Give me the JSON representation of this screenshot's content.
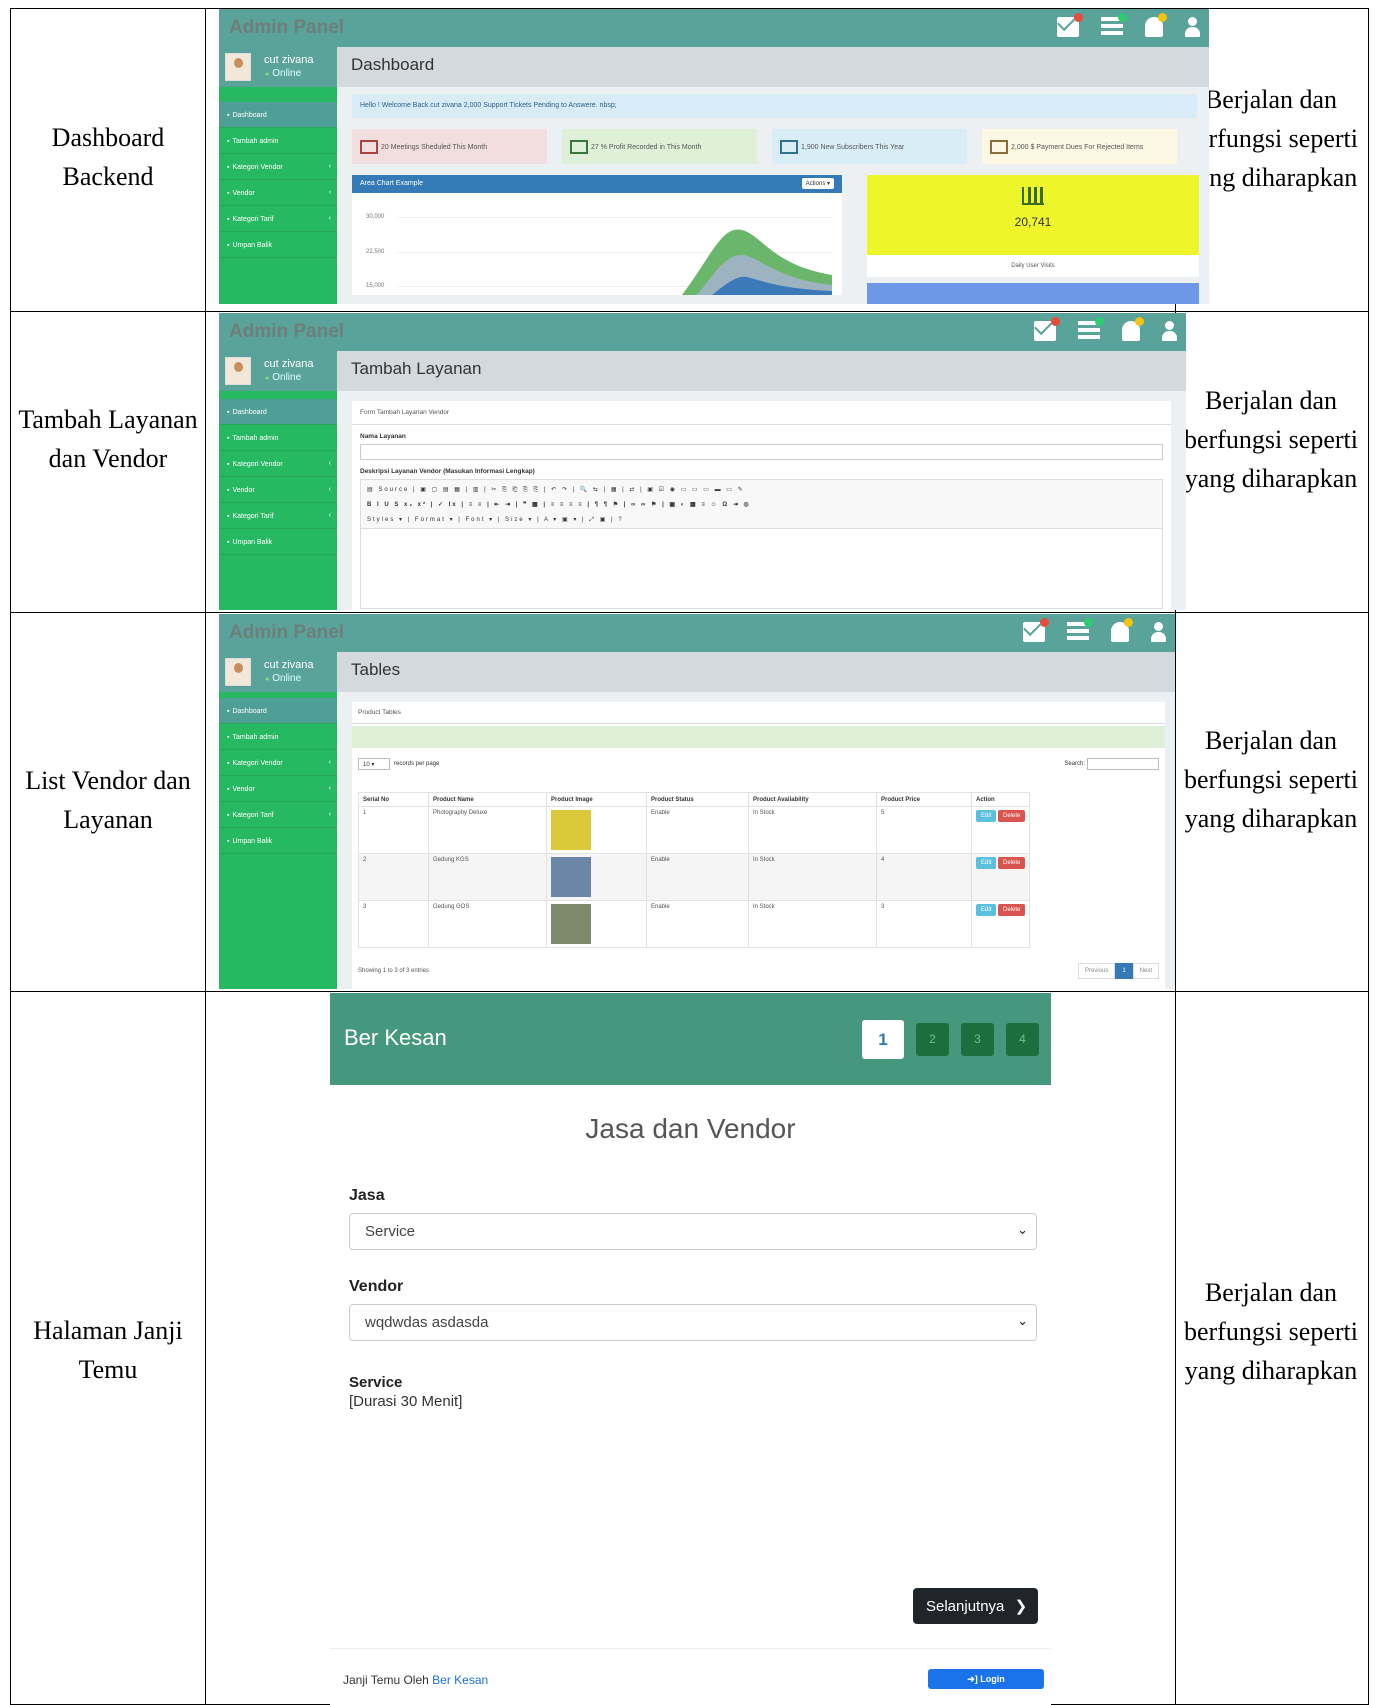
{
  "rows": [
    {
      "label": "Dashboard Backend",
      "result": "Berjalan dan berfungsi seperti yang diharapkan"
    },
    {
      "label": "Tambah Layanan dan Vendor",
      "result": "Berjalan dan berfungsi seperti yang diharapkan"
    },
    {
      "label": "List Vendor dan Layanan",
      "result": "Berjalan dan berfungsi seperti yang diharapkan"
    },
    {
      "label": "Halaman Janji Temu",
      "result": "Berjalan dan berfungsi seperti yang diharapkan"
    }
  ],
  "admin": {
    "title": "Admin Panel",
    "user": "cut zivana",
    "status": "Online",
    "nav": [
      "Dashboard",
      "Tambah admin",
      "Kategori Vendor",
      "Vendor",
      "Kategori Tarif",
      "Umpan Balik"
    ],
    "chevron": "‹"
  },
  "dashboard": {
    "heading": "Dashboard",
    "welcome": "Hello ! Welcome Back cut zivana  2,000 Support Tickets Pending to Answere. nbsp;",
    "stats": [
      {
        "text": "20 Meetings Sheduled This Month",
        "bg": "#f2dede",
        "color": "#a94442"
      },
      {
        "text": "27 % Profit Recorded in This Month",
        "bg": "#dff0d8",
        "color": "#3c763d"
      },
      {
        "text": "1,900 New Subscribers This Year",
        "bg": "#d9edf7",
        "color": "#31708f"
      },
      {
        "text": "2,000 $ Payment Dues For Rejected Items",
        "bg": "#fcf8e3",
        "color": "#8a6d3b"
      }
    ],
    "chart_title": "Area Chart Example",
    "chart_actions": "Actions ▾",
    "ticks": [
      "30,000",
      "22,500",
      "15,000"
    ],
    "visits": "20,741",
    "visits_label": "Daily User Visits"
  },
  "tambah": {
    "heading": "Tambah Layanan",
    "form_title": "Form Tambah Layanan Vendor",
    "name_label": "Nama Layanan",
    "desc_label": "Deskripsi Layanan Vendor (Masukan Informasi Lengkap)",
    "toolbar1": "▤ Source | ▣ ▢ ▤ ▦ | ▥ | ✂ ⎘ ⎗ ⎘ ⎘ | ↶ ↷ | 🔍 ⇆ | ▦ | ⇄ | ▣ ☑ ◉ ▭ ▭ ▭ ▬ ▭ ✎",
    "toolbar2": "B I U S x₂ x² | ✓ Ix | ≡ ≡ | ⇤ ⇥ | ❞ ▦ | ≡ ≡ ≡ ≡ | ¶ ¶ ⚑ | ∞ ∞ ⚑ | ▣ ◐ ▦ ≡ ☺ Ω ⇥ ◎",
    "toolbar3": "Styles  ▾ | Format  ▾ | Font  ▾ | Size  ▾ | A ▾ ▣ ▾ | ⤢ ▣ | ?"
  },
  "tables": {
    "heading": "Tables",
    "panel_title": "Product Tables",
    "per_page": "10",
    "per_page_label": "records per page",
    "search_label": "Search:",
    "columns": [
      "Serial No",
      "Product Name",
      "Product Image",
      "Product Status",
      "Product Availability",
      "Product Price",
      "Action"
    ],
    "rows": [
      {
        "no": "1",
        "name": "Photography Deluxe",
        "status": "Enable",
        "avail": "In Stock",
        "price": "5",
        "img": "#d9c83a"
      },
      {
        "no": "2",
        "name": "Gedung KGS",
        "status": "Enable",
        "avail": "In Stock",
        "price": "4",
        "img": "#6b86a6"
      },
      {
        "no": "3",
        "name": "Gedung GOS",
        "status": "Enable",
        "avail": "In Stock",
        "price": "3",
        "img": "#7f8a6c"
      }
    ],
    "edit": "Edit",
    "delete": "Delete",
    "showing": "Showing 1 to 3 of 3 entries",
    "prev": "Previous",
    "page": "1",
    "next": "Next"
  },
  "booking": {
    "brand": "Ber Kesan",
    "steps": [
      "1",
      "2",
      "3",
      "4"
    ],
    "title": "Jasa dan Vendor",
    "jasa_label": "Jasa",
    "jasa_value": "Service",
    "vendor_label": "Vendor",
    "vendor_value": "wqdwdas asdasda",
    "service_title": "Service",
    "service_duration": "[Durasi 30 Menit]",
    "next": "Selanjutnya",
    "footer_text": "Janji Temu Oleh",
    "footer_link": "Ber Kesan",
    "login": "Login"
  }
}
